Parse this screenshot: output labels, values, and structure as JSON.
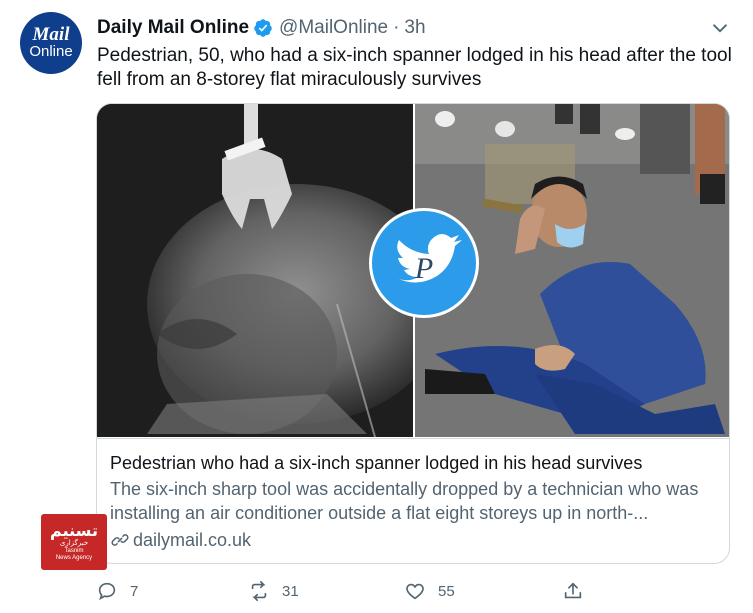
{
  "tweet": {
    "author_name": "Daily Mail Online",
    "handle": "@MailOnline",
    "separator": "·",
    "time": "3h",
    "text": "Pedestrian, 50, who had a six-inch spanner lodged in his head after the tool fell from an 8-storey flat miraculously survives",
    "avatar": {
      "line1": "Mail",
      "line2": "Online"
    }
  },
  "card": {
    "title": "Pedestrian who had a six-inch spanner lodged in his head survives",
    "description": "The six-inch sharp tool was accidentally dropped by a technician who was installing an air conditioner outside a flat eight storeys up in north-...",
    "domain": "dailymail.co.uk"
  },
  "watermark_logo": {
    "line1": "تسنیم",
    "line2": "خبرگزاری",
    "line3": "Tasnim",
    "line4": "News Agency"
  },
  "actions": {
    "reply_count": "7",
    "retweet_count": "31",
    "like_count": "55"
  },
  "colors": {
    "verified": "#1d9bf0",
    "secondary_text": "#536471",
    "border": "#cfd9de",
    "avatar_bg": "#0f3f8c",
    "tasnim_red": "#c62828"
  },
  "icons": [
    "verified-badge-icon",
    "chevron-down-icon",
    "link-icon",
    "reply-icon",
    "retweet-icon",
    "like-icon",
    "share-icon",
    "twitter-bird-watermark-icon"
  ]
}
